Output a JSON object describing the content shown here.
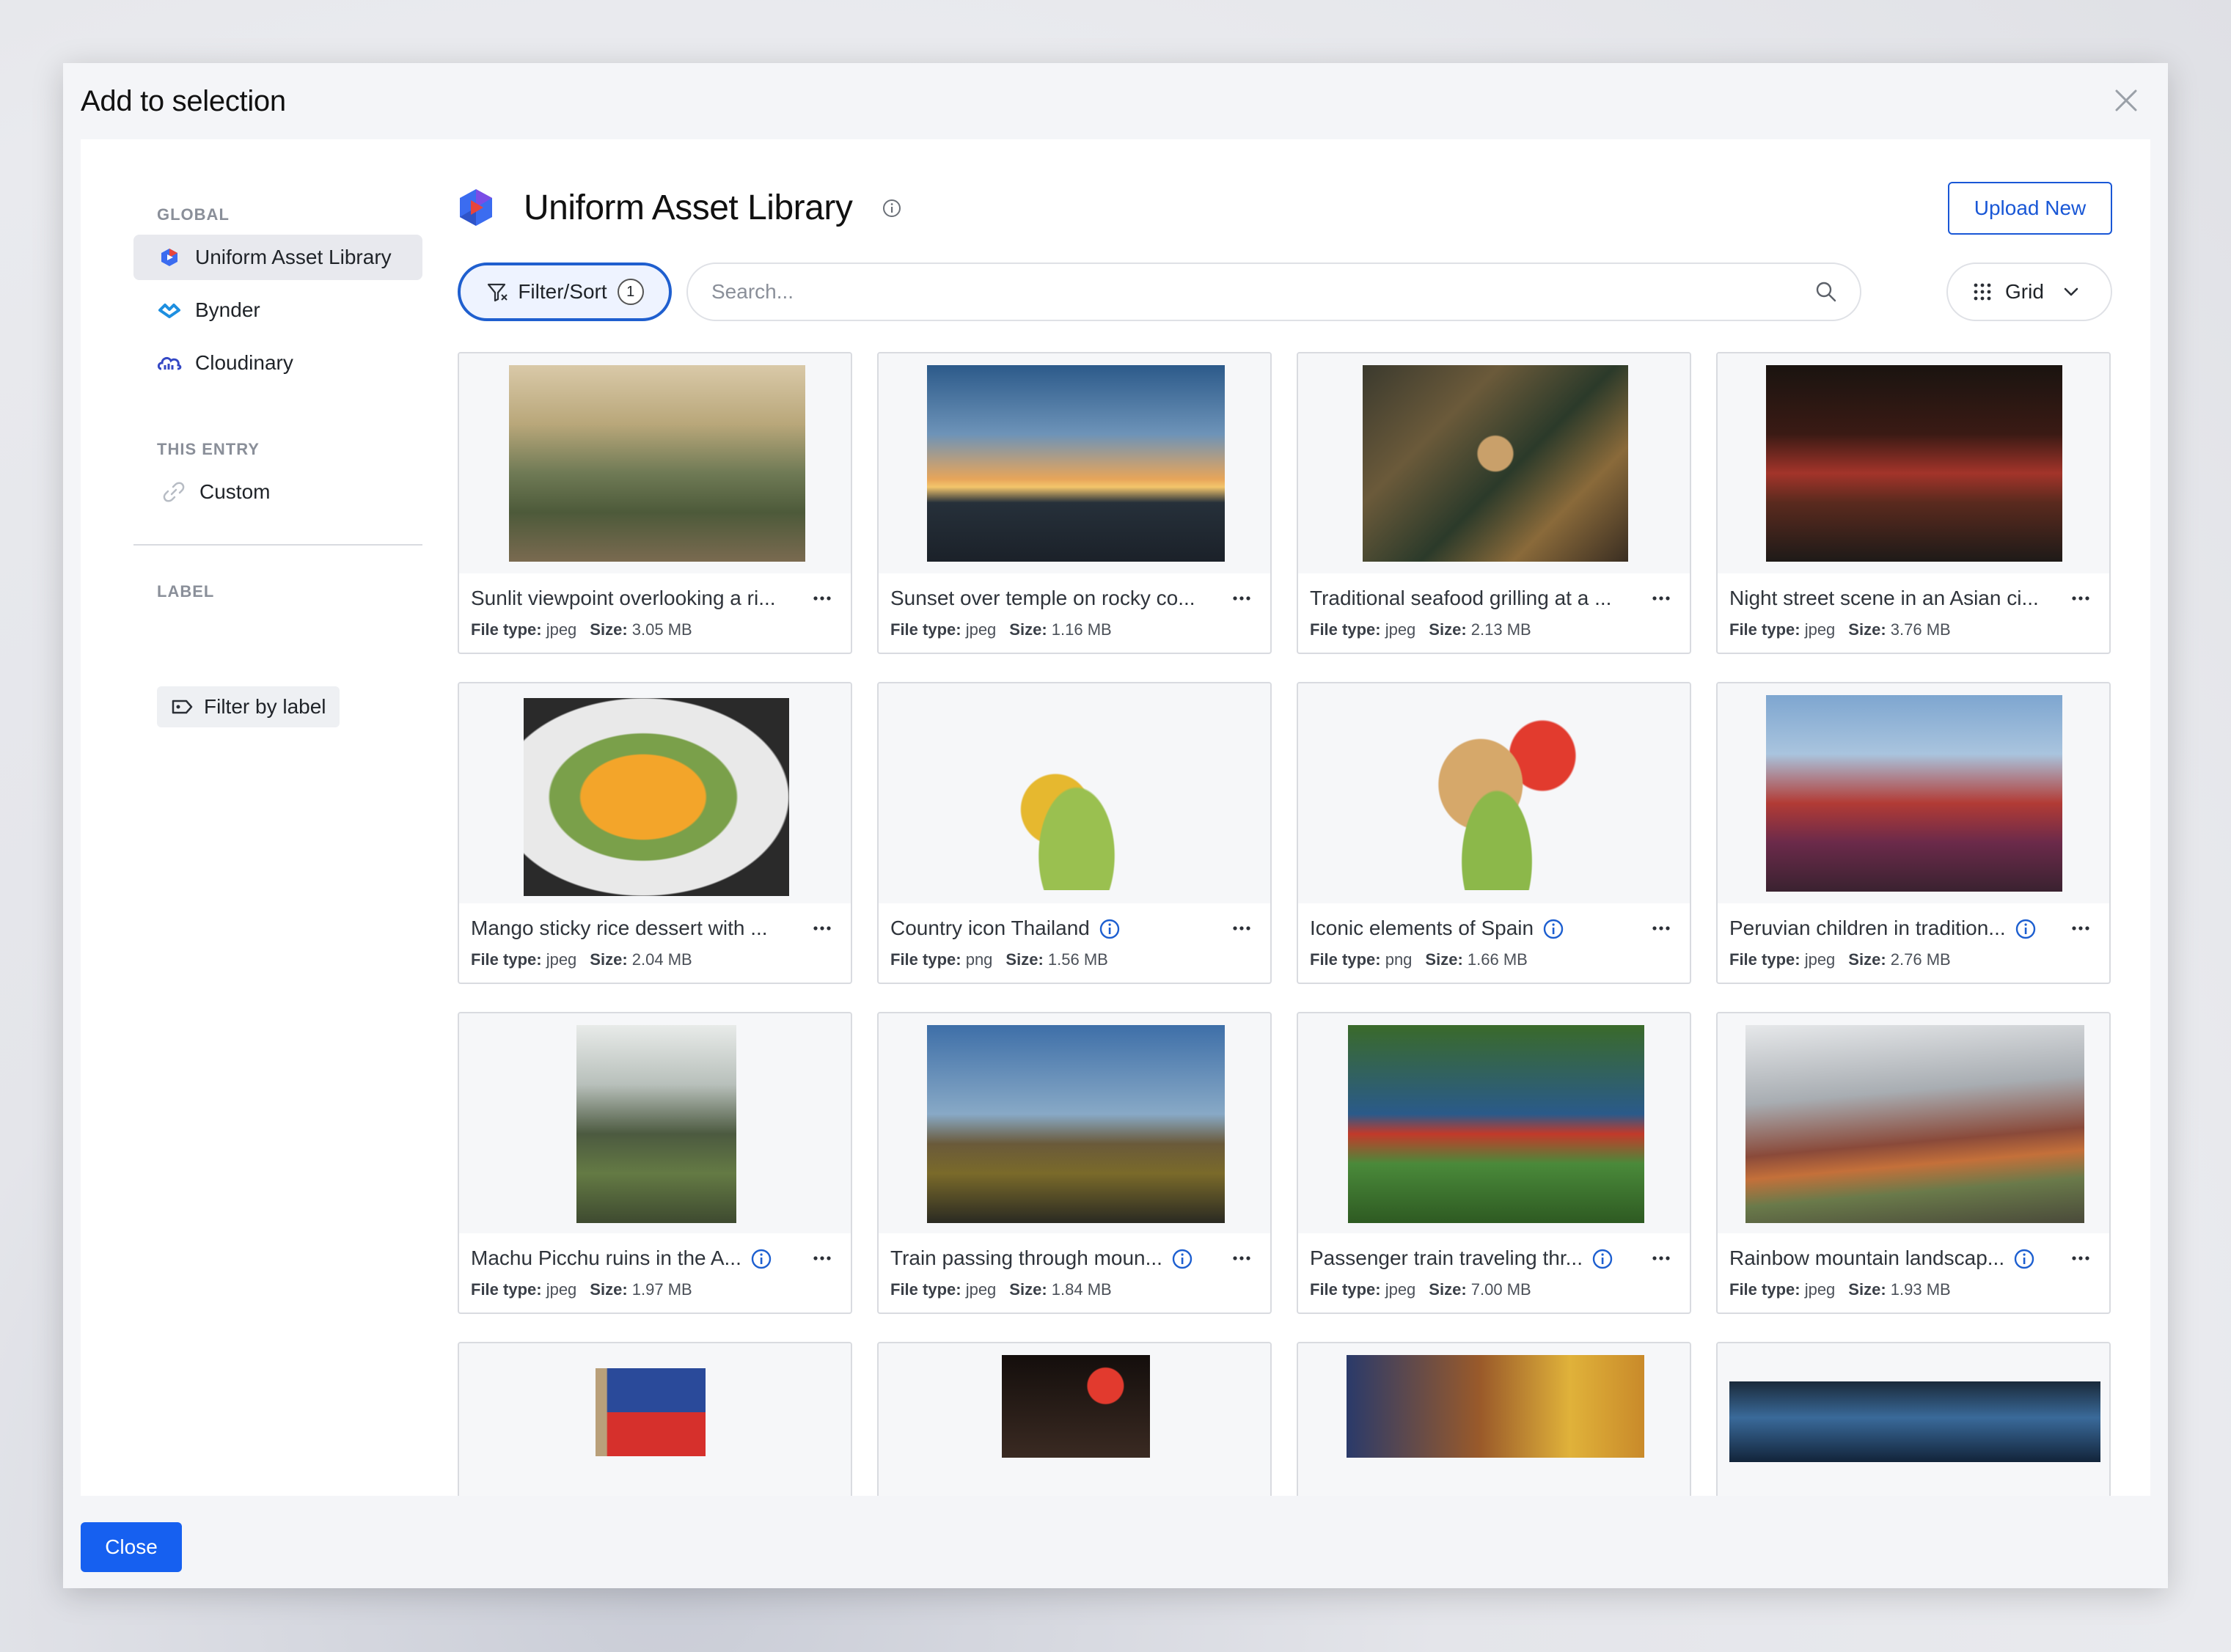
{
  "modal": {
    "title": "Add to selection",
    "close_button": "Close"
  },
  "sidebar": {
    "global_heading": "GLOBAL",
    "global_items": [
      {
        "label": "Uniform Asset Library",
        "icon": "uniform-logo-icon",
        "active": true
      },
      {
        "label": "Bynder",
        "icon": "bynder-logo-icon",
        "active": false
      },
      {
        "label": "Cloudinary",
        "icon": "cloudinary-logo-icon",
        "active": false
      }
    ],
    "entry_heading": "THIS ENTRY",
    "entry_items": [
      {
        "label": "Custom",
        "icon": "link-icon"
      }
    ],
    "label_heading": "LABEL",
    "label_filter": "Filter by label"
  },
  "library": {
    "title": "Uniform Asset Library",
    "upload_label": "Upload New",
    "filter_label": "Filter/Sort",
    "filter_count": "1",
    "search_placeholder": "Search...",
    "view_label": "Grid"
  },
  "assets": [
    {
      "name": "Sunlit viewpoint overlooking a ri...",
      "type": "jpeg",
      "size": "3.05 MB",
      "info": false
    },
    {
      "name": "Sunset over temple on rocky co...",
      "type": "jpeg",
      "size": "1.16 MB",
      "info": false
    },
    {
      "name": "Traditional seafood grilling at a ...",
      "type": "jpeg",
      "size": "2.13 MB",
      "info": false
    },
    {
      "name": "Night street scene in an Asian ci...",
      "type": "jpeg",
      "size": "3.76 MB",
      "info": false
    },
    {
      "name": "Mango sticky rice dessert with ...",
      "type": "jpeg",
      "size": "2.04 MB",
      "info": false
    },
    {
      "name": "Country icon Thailand",
      "type": "png",
      "size": "1.56 MB",
      "info": true
    },
    {
      "name": "Iconic elements of Spain",
      "type": "png",
      "size": "1.66 MB",
      "info": true
    },
    {
      "name": "Peruvian children in tradition...",
      "type": "jpeg",
      "size": "2.76 MB",
      "info": true
    },
    {
      "name": "Machu Picchu ruins in the A...",
      "type": "jpeg",
      "size": "1.97 MB",
      "info": true
    },
    {
      "name": "Train passing through moun...",
      "type": "jpeg",
      "size": "1.84 MB",
      "info": true
    },
    {
      "name": "Passenger train traveling thr...",
      "type": "jpeg",
      "size": "7.00 MB",
      "info": true
    },
    {
      "name": "Rainbow mountain landscap...",
      "type": "jpeg",
      "size": "1.93 MB",
      "info": true
    },
    {
      "name": "",
      "type": "",
      "size": "",
      "info": false
    },
    {
      "name": "",
      "type": "",
      "size": "",
      "info": false
    },
    {
      "name": "",
      "type": "",
      "size": "",
      "info": false
    },
    {
      "name": "",
      "type": "",
      "size": "",
      "info": false
    }
  ],
  "meta_labels": {
    "type": "File type:",
    "size": "Size:"
  },
  "colors": {
    "accent": "#1660f0",
    "link_blue": "#1957d6",
    "info_blue": "#1d5fd0"
  }
}
